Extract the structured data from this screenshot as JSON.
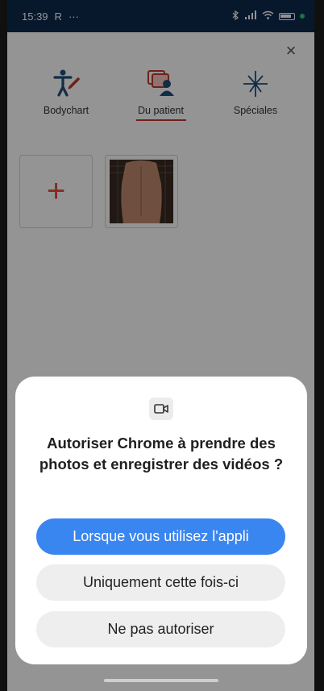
{
  "status_bar": {
    "time": "15:39",
    "carrier_letter": "R",
    "overflow": "···"
  },
  "header": {
    "close_label": "×"
  },
  "tabs": [
    {
      "label": "Bodychart",
      "icon": "bodychart-icon"
    },
    {
      "label": "Du patient",
      "icon": "patient-photos-icon",
      "active": true
    },
    {
      "label": "Spéciales",
      "icon": "specials-icon"
    }
  ],
  "gallery": {
    "add_symbol": "+"
  },
  "dialog": {
    "icon": "camera-icon",
    "title": "Autoriser Chrome à prendre des photos et enregistrer des vidéos ?",
    "buttons": {
      "while_using": "Lorsque vous utilisez l'appli",
      "only_once": "Uniquement cette fois-ci",
      "deny": "Ne pas autoriser"
    }
  },
  "colors": {
    "accent_red": "#c0392b",
    "primary_blue": "#3a86f0",
    "status_bar": "#0e2a4d",
    "tab_icon_blue": "#1f4e79"
  }
}
